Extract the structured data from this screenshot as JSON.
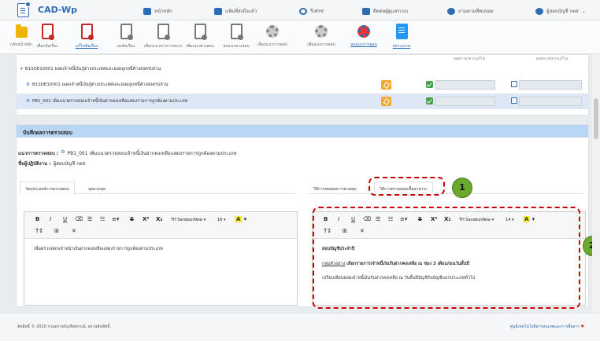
{
  "app": {
    "title": "CAD-Wp"
  },
  "topnav": {
    "home": "หน้าหลัก",
    "sent": "แฟ้มที่ส่งถึงแล้ว",
    "refresh": "รีเฟรช",
    "contact": "ติดต่อผู้ดูแลระบบ",
    "help": "ถามตามที่พบบ่อย",
    "user": "ผู้สอบบัญชี กตส"
  },
  "toolbar": [
    {
      "label": "กลับหน้าหลัก",
      "icon": "folder-icon"
    },
    {
      "label": "เลือกข้อเรื่อง",
      "icon": "document-red-icon"
    },
    {
      "label": "แก้ไขข้อเรื่อง",
      "icon": "document-red-icon"
    },
    {
      "label": "ลบข้อเรื่อง",
      "icon": "document-gray-icon"
    },
    {
      "label": "เลือกแนวทางการตรวจสอบ",
      "icon": "document-gray-icon"
    },
    {
      "label": "เพิ่มแนวทางสอบ",
      "icon": "document-gray-icon"
    },
    {
      "label": "ลบแนวทางสอบ",
      "icon": "document-gray-icon"
    },
    {
      "label": "เลือกแนวการสอบ",
      "icon": "gear-icon"
    },
    {
      "label": "เพิ่มแนวการสอบ",
      "icon": "gear-icon"
    },
    {
      "label": "ลบแนวการสอบ",
      "icon": "gear-icon"
    },
    {
      "label": "ส่งรายงาน",
      "icon": "report-icon"
    }
  ],
  "panel1": {
    "col1": "ผลตรวจ/ควรแก้ไข",
    "col2": "ผลตรวจ/ควรแก้ไข",
    "group": "B1SDE10001 ยอดเจ้าหนี้เงินกู้ต่างประเทศและยอดลูกหนี้ค้างส่งครบถ้วน",
    "rows": [
      "B1SDE10001 ยอดเจ้าหนี้เงินกู้ต่างประเทศและยอดลูกหนี้ค้างส่งครบถ้วน",
      "PB1_001 เพิ่มแนวตรวจสอบเจ้าหนี้เงินฝากคงเหลือแสดงรายการถูกต้องตามประเภท"
    ]
  },
  "panel2": {
    "header": "บันทึกผลการตรวจสอบ",
    "auditline_label": "แนวการตรวจสอบ :",
    "auditline_value": "PB1_001 เพิ่มแนวตรวจสอบเจ้าหนี้เงินฝากคงเหลือแสดงรายการถูกต้องตามประเภท",
    "auditor_label": "ชื่อผู้ปฏิบัติงาน :",
    "auditor_value": "ผู้สอบบัญชี กตส",
    "left_tabs": [
      "วัตถุประสงค์การตรวจสอบ",
      "จุดควบคุม"
    ],
    "right_tabs": [
      "วิธีการทดสอบการควบคุม",
      "วิธีการตรวจสอบเนื้อหาสาระ"
    ],
    "editor": {
      "font": "TH SarabunNew ▾",
      "size_left": "16 ▾",
      "size_right": "14 ▾",
      "bold": "B",
      "italic": "I",
      "underline": "U",
      "strike": "S",
      "sup": "X²",
      "sub": "X₂",
      "hilite": "A",
      "fontsize": "T↕",
      "table": "⊞",
      "clean": "✕"
    },
    "left_text": "เพื่อตรวจสอบเจ้าหน้าเงินฝากคงเหลือแสดงรายการถูกต้องตามประเภท",
    "right_title": "สอบบัญชีประจำปี",
    "right_link": "กลุ่มตัวอย่าง",
    "right_line1": " เลือกรายการเจ้าหนี้เงินรับฝากคงเหลือ ณ ช่อง 3 เดือนก่อนวันสิ้นปี",
    "right_line2": "เปรียบเทียบยอดเจ้าหนี้เงินรับฝากคงเหลือ ณ วันสิ้นปีบัญชีกับบัญชีแยกประเภททั่วไป"
  },
  "markers": {
    "one": "1",
    "two": "2"
  },
  "footer": {
    "left": "ลิขสิทธิ์ © 2020 กรมตรวจบัญชีสหกรณ์, สงวนลิขสิทธิ์.",
    "right": "ศูนย์เทคโนโลยีสารสนเทศและการสื่อสาร"
  },
  "colors": {
    "accent": "#2c6db6",
    "header_band": "#b9d7f4",
    "annotation_red": "#cc0000",
    "annotation_green": "#6aa82e"
  }
}
